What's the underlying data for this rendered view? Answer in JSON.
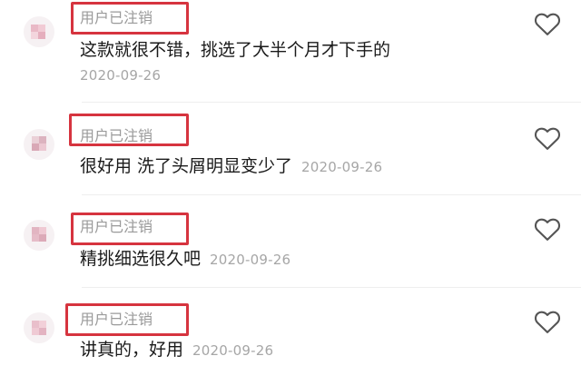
{
  "comments": [
    {
      "username": "用户已注销",
      "text": "这款就很不错，挑选了大半个月才下手的",
      "date": "2020-09-26"
    },
    {
      "username": "用户已注销",
      "text": "很好用 洗了头屑明显变少了",
      "date": "2020-09-26"
    },
    {
      "username": "用户已注销",
      "text": "精挑细选很久吧",
      "date": "2020-09-26"
    },
    {
      "username": "用户已注销",
      "text": "讲真的，好用",
      "date": "2020-09-26"
    }
  ],
  "colors": {
    "highlight_border": "#d6343f",
    "username_text": "#9a9a9a",
    "date_text": "#a6a6a6",
    "like_icon": "#555555"
  },
  "icons": {
    "like": "heart-outline-icon",
    "avatar": "pixelated-avatar"
  }
}
